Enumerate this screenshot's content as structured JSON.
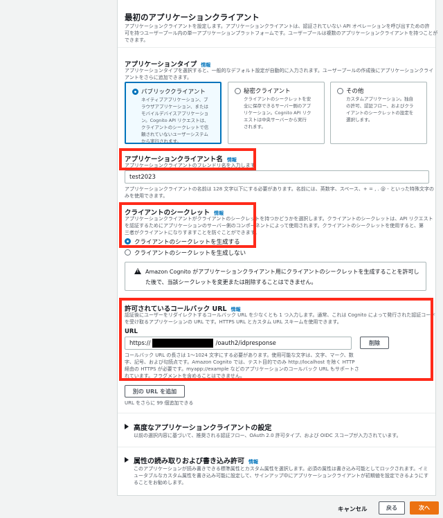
{
  "section_title": "最初のアプリケーションクライアント",
  "section_desc_1": "アプリケーションクライアントを設定します。アプリケーションクライアントは、認証されていない API オペレーションを呼び出すための許",
  "section_desc_2": "可を持つユーザープール内の単一アプリケーションプラットフォームです。ユーザープールは複数のアプリケーションクライアントを持つことが",
  "section_desc_3": "できます。",
  "info": "情報",
  "app_type": {
    "label": "アプリケーションタイプ",
    "desc_1": "アプリケーションタイプを選択すると、一般的なデフォルト設定が自動的に入力されます。ユーザープールの作成後にアプリケーションクライ",
    "desc_2": "アントをさらに追加できます。",
    "options": [
      {
        "title": "パブリッククライアント",
        "lines": [
          "ネイティブアプリケーション、ブ",
          "ラウザアプリケーション、または",
          "モバイルデバイスアプリケーショ",
          "ン。Cognito API リクエストは、",
          "クライアントのシークレットで信",
          "頼されていないユーザーシステム",
          "から実行されます。"
        ]
      },
      {
        "title": "秘密クライアント",
        "lines": [
          "クライアントのシークレットを安",
          "全に保存できるサーバー側のアプ",
          "リケーション。Cognito API リク",
          "エストは中央サーバーから実行",
          "されます。"
        ]
      },
      {
        "title": "その他",
        "lines": [
          "カスタムアプリケーション。独自",
          "の許可、認証フロー、およびクラ",
          "イアントのシークレットの設定を",
          "選択します。"
        ]
      }
    ]
  },
  "client_name": {
    "label": "アプリケーションクライアント名",
    "desc": "アプリケーションクライアントのフレンドリ名を入力します",
    "value": "test2023",
    "hint_1": "アプリケーションクライアントの名前は 128 文字以下にする必要があります。名前には、英数字、スペース、+ = , . @ - といった特殊文字の",
    "hint_2": "みを使用できます。"
  },
  "secret": {
    "label": "クライアントのシークレット",
    "desc_1": "アプリケーションクライアントがクライアントのシークレットを持つかどうかを選択します。クライアントのシークレットは、API リクエスト",
    "desc_2": "を認証するためにアプリケーションのサーバー側のコンポーネントによって使用されます。クライアントのシークレットを使用すると、第",
    "desc_3": "三者がクライアントになりすますことを防ぐことができます。",
    "option_generate": "クライアントのシークレットを生成する",
    "option_none": "クライアントのシークレットを生成しない",
    "warning_1": "Amazon Cognito がアプリケーションクライアント用にクライアントのシークレットを生成することを許可し",
    "warning_2": "た後で、当該シークレットを変更または削除することはできません。"
  },
  "callback": {
    "label": "許可されているコールバック URL",
    "desc_1": "認証後にユーザーをリダイレクトするコールバック URL を少なくとも 1 つ入力します。通常、これは Cognito によって発行された認証コード",
    "desc_2": "を受け取るアプリケーションの URL です。HTTPS URL とカスタム URL スキームを使用できます。",
    "url_label": "URL",
    "url_prefix": "https://",
    "url_suffix": "/oauth2/idpresponse",
    "remove_button": "削除",
    "hint_1": "コールバック URL の長さは 1～1024 文字にする必要があります。使用可能な文字は、文字、マーク、数",
    "hint_2": "字、記号、および句読点です。Amazon Cognito では、テスト目的でのみ http://localhost を除く HTTP",
    "hint_3": "経由の HTTPS が必要です。myapp://example などのアプリケーションのコールバック URL もサポートさ",
    "hint_4": "れています。フラグメントを含めることはできません。",
    "add_button": "別の URL を追加",
    "add_hint": "URL をさらに 99 個追加できる"
  },
  "advanced": {
    "title": "高度なアプリケーションクライアントの設定",
    "desc": "以前の選択内容に基づいて、推奨される認証フロー、OAuth 2.0 許可タイプ、および OIDC スコープが入力されています。"
  },
  "attributes": {
    "title": "属性の読み取りおよび書き込み許可",
    "desc_1": "このアプリケーションが読み書きできる標準属性とカスタム属性を選択します。必須の属性は書き込み可能としてロックされます。イミ",
    "desc_2": "ュータブルなカスタム属性を書き込み可能に設定して、サインアップ中にアプリケーションクライアントが初期値を設定できるようにす",
    "desc_3": "ることをお勧めします。"
  },
  "footer": {
    "cancel": "キャンセル",
    "back": "戻る",
    "next": "次へ"
  },
  "colors": {
    "accent": "#0073bb",
    "primary_button": "#ec7211",
    "highlight_box": "#ff2a1a"
  }
}
